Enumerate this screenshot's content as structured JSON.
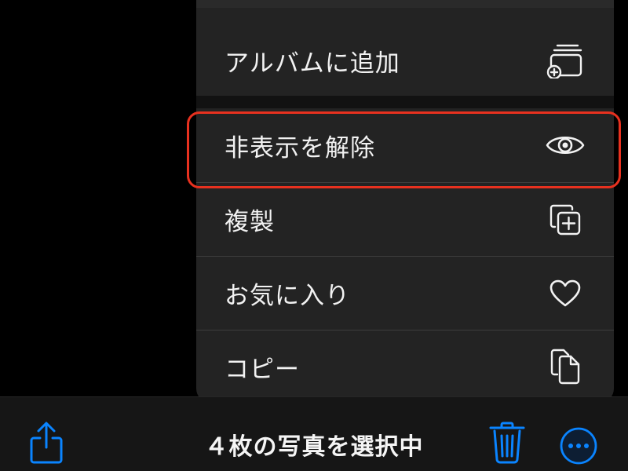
{
  "menu": {
    "items": [
      {
        "label": "アルバムに追加",
        "icon": "add-to-album-icon"
      },
      {
        "label": "非表示を解除",
        "icon": "eye-icon"
      },
      {
        "label": "複製",
        "icon": "duplicate-icon"
      },
      {
        "label": "お気に入り",
        "icon": "heart-icon"
      },
      {
        "label": "コピー",
        "icon": "copy-icon"
      }
    ]
  },
  "toolbar": {
    "title": "４枚の写真を選択中",
    "share_icon": "share-icon",
    "trash_icon": "trash-icon",
    "more_icon": "more-icon"
  },
  "colors": {
    "background": "#000000",
    "menu_background": "#232323",
    "text": "#f2f2f2",
    "accent_blue": "#0a84ff",
    "highlight_red": "#e8311f"
  }
}
